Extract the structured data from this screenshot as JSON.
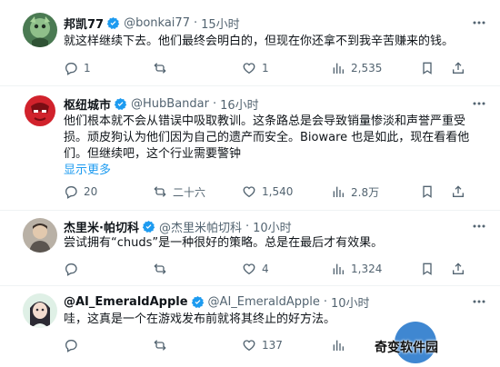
{
  "tweets": [
    {
      "name": "邦凯77",
      "handle": "@bonkai77",
      "time": "15小时",
      "text": "就这样继续下去。他们最终会明白的，但现在你还拿不到我辛苦赚来的钱。",
      "replies": "1",
      "reposts": "",
      "likes": "1",
      "views": "2,535"
    },
    {
      "name": "枢纽城市",
      "handle": "@HubBandar",
      "time": "16小时",
      "text": "他们根本就不会从错误中吸取教训。这条路总是会导致销量惨淡和声誉严重受损。顽皮狗认为他们因为自己的遗产而安全。Bioware 也是如此，现在看看他们。但继续吧，这个行业需要警钟",
      "show_more": "显示更多",
      "replies": "20",
      "reposts": "二十六",
      "likes": "1,540",
      "views": "2.8万"
    },
    {
      "name": "杰里米·帕切科",
      "handle": "@杰里米帕切科",
      "time": "10小时",
      "text": "尝试拥有“chuds”是一种很好的策略。总是在最后才有效果。",
      "replies": "",
      "reposts": "",
      "likes": "4",
      "views": "1,324"
    },
    {
      "name": "@AI_EmeraldApple",
      "handle": "@AI_EmeraldApple",
      "time": "10小时",
      "text": "哇，这真是一个在游戏发布前就将其终止的好方法。",
      "replies": "",
      "reposts": "",
      "likes": "137",
      "views": ""
    }
  ],
  "separator": "·",
  "watermark": "奇变软件园",
  "colors": {
    "accent": "#1d9bf0",
    "muted": "#536471",
    "divider": "#eff3f4"
  }
}
